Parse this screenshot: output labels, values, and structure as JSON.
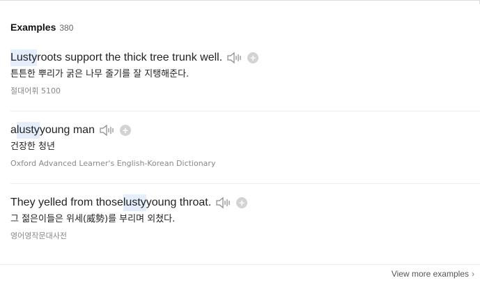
{
  "header": {
    "title": "Examples",
    "count": "380"
  },
  "examples": [
    {
      "parts": [
        "",
        "Lusty",
        " roots support the thick tree trunk well."
      ],
      "ko": "튼튼한 뿌리가 굵은 나무 줄기를 잘 지탱해준다.",
      "source": "절대어휘 5100"
    },
    {
      "parts": [
        "a ",
        "lusty",
        " young man"
      ],
      "ko": "건장한 청년",
      "source": "Oxford Advanced Learner's English-Korean Dictionary"
    },
    {
      "parts": [
        "They yelled from those ",
        "lusty",
        " young throat."
      ],
      "ko": "그 젊은이들은 위세(威勢)를 부리며 외쳤다.",
      "source": "영어영작문대사전"
    }
  ],
  "footer": {
    "view_more": "View more examples",
    "chevron": "›"
  },
  "icons": {
    "speaker": "speaker-icon",
    "add": "plus-icon"
  },
  "colors": {
    "highlight": "#e4eefc",
    "plus_bg": "#d3d3d3"
  }
}
